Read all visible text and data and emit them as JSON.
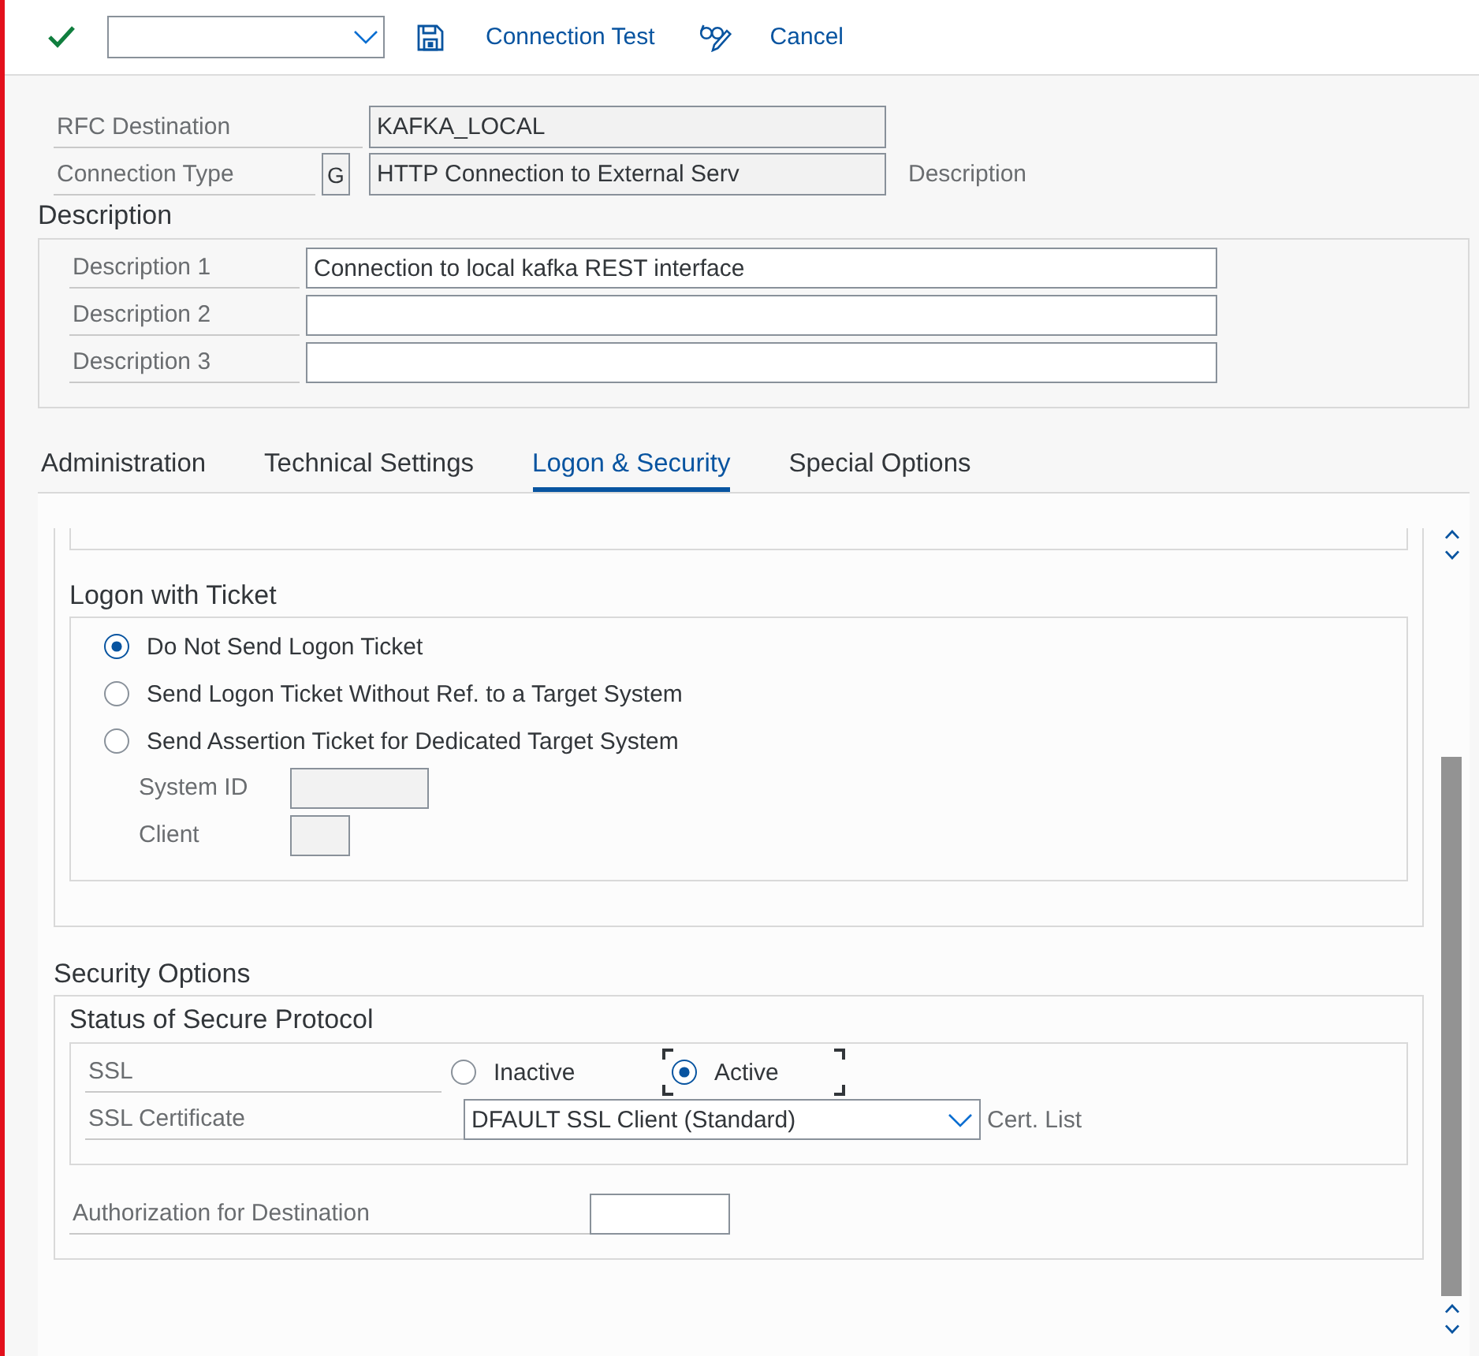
{
  "toolbar": {
    "buttons": [
      {
        "label": "Connection Test"
      },
      {
        "label": "Cancel"
      }
    ]
  },
  "header": {
    "fields": [
      {
        "label": "RFC Destination",
        "value": "KAFKA_LOCAL",
        "readonly": true
      },
      {
        "label": "Connection Type",
        "code": "G",
        "value": "HTTP Connection to External Serv",
        "readonly": true,
        "trailing_text": "Description"
      }
    ]
  },
  "description": {
    "title": "Description",
    "fields": [
      {
        "label": "Description 1",
        "value": "Connection to local kafka REST interface",
        "readonly": false
      },
      {
        "label": "Description 2",
        "readonly": false
      },
      {
        "label": "Description 3",
        "readonly": false
      }
    ]
  },
  "tabs": [
    {
      "label": "Administration",
      "selected": false
    },
    {
      "label": "Technical Settings",
      "selected": false
    },
    {
      "label": "Logon & Security",
      "selected": true
    },
    {
      "label": "Special Options",
      "selected": false
    }
  ],
  "logon_with_ticket": {
    "title": "Logon with Ticket",
    "options": [
      {
        "label": "Do Not Send Logon Ticket",
        "selected": true
      },
      {
        "label": "Send Logon Ticket Without Ref. to a Target System",
        "selected": false
      },
      {
        "label": "Send Assertion Ticket for Dedicated Target System",
        "selected": false
      }
    ],
    "fields": [
      {
        "label": "System ID",
        "readonly": true
      },
      {
        "label": "Client",
        "readonly": true
      }
    ]
  },
  "security_options": {
    "title": "Security Options",
    "protocol": {
      "title": "Status of Secure Protocol",
      "ssl": {
        "label": "SSL",
        "options": [
          {
            "label": "Inactive",
            "selected": false,
            "focused": false
          },
          {
            "label": "Active",
            "selected": true,
            "focused": true
          }
        ]
      },
      "certificate": {
        "label": "SSL Certificate",
        "value": "DFAULT SSL Client (Standard)",
        "trailing_text": "Cert. List"
      }
    },
    "authorization": {
      "label": "Authorization for Destination",
      "readonly": false
    }
  }
}
